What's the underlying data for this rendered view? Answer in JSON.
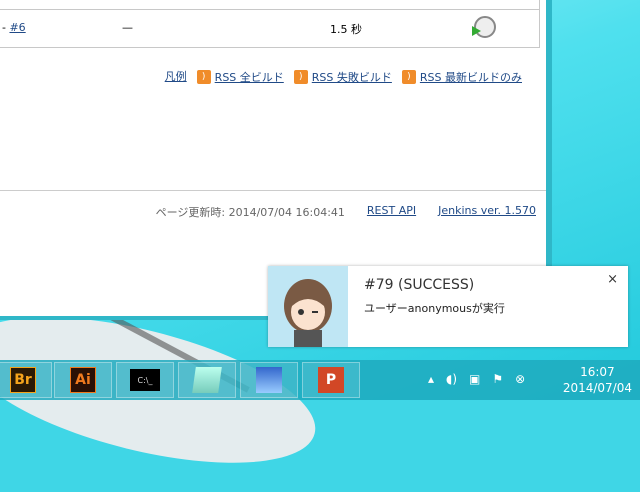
{
  "table": {
    "build_link": "#6",
    "dash": "—",
    "duration": "1.5 秒"
  },
  "links": {
    "legend": "凡例",
    "rss_all": "RSS 全ビルド",
    "rss_failed": "RSS 失敗ビルド",
    "rss_latest": "RSS 最新ビルドのみ"
  },
  "footer": {
    "updated": "ページ更新時: 2014/07/04 16:04:41",
    "rest_api": "REST API",
    "version": "Jenkins ver. 1.570"
  },
  "toast": {
    "title": "#79 (SUCCESS)",
    "message": "ユーザーanonymousが実行",
    "close": "×"
  },
  "taskbar": {
    "apps": [
      {
        "label": "Br",
        "color": "#f4a41c"
      },
      {
        "label": "Ai",
        "color": "#f07a1e"
      },
      {
        "label": "C:\\_",
        "color": "#ddd"
      },
      {
        "label": "",
        "color": "#7ec"
      },
      {
        "label": "",
        "color": "#36c"
      },
      {
        "label": "P",
        "color": "#d24726"
      }
    ],
    "time": "16:07",
    "date": "2014/07/04"
  }
}
